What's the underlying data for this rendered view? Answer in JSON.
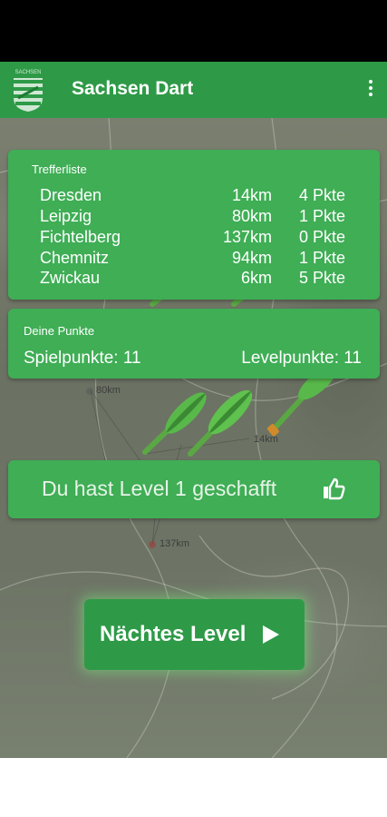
{
  "app": {
    "title": "Sachsen Dart",
    "logo_text": "SACHSEN"
  },
  "colors": {
    "primary": "#2e9a47",
    "panel": "#3fae55",
    "dart": "#58b94a"
  },
  "hits": {
    "caption": "Trefferliste",
    "rows": [
      {
        "city": "Dresden",
        "distance": "14km",
        "points": "4 Pkte"
      },
      {
        "city": "Leipzig",
        "distance": "80km",
        "points": "1 Pkte"
      },
      {
        "city": "Fichtelberg",
        "distance": "137km",
        "points": "0 Pkte"
      },
      {
        "city": "Chemnitz",
        "distance": "94km",
        "points": "1 Pkte"
      },
      {
        "city": "Zwickau",
        "distance": "6km",
        "points": "5 Pkte"
      }
    ]
  },
  "score": {
    "caption": "Deine Punkte",
    "game_points": "Spielpunkte: 11",
    "level_points": "Levelpunkte: 11"
  },
  "result": {
    "message": "Du hast Level 1 geschafft",
    "icon": "thumbs-up-icon"
  },
  "map": {
    "labels": {
      "leipzig": "80km",
      "dresden": "14km",
      "fichtelberg": "137km"
    }
  },
  "next": {
    "label": "Nächtes Level",
    "icon": "play-icon"
  },
  "icons": {
    "menu": "more-vert-icon",
    "logo": "saxony-coat-of-arms-icon"
  }
}
